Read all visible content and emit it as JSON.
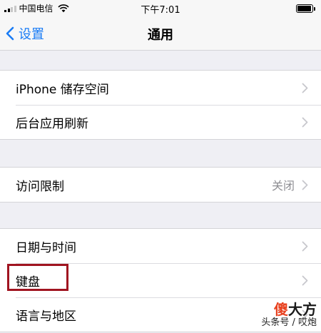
{
  "status_bar": {
    "carrier": "中国电信",
    "time": "下午7:01"
  },
  "nav": {
    "back_label": "设置",
    "title": "通用"
  },
  "groups": [
    {
      "rows": [
        {
          "label": "iPhone 储存空间",
          "value": ""
        },
        {
          "label": "后台应用刷新",
          "value": ""
        }
      ]
    },
    {
      "rows": [
        {
          "label": "访问限制",
          "value": "关闭"
        }
      ]
    },
    {
      "rows": [
        {
          "label": "日期与时间",
          "value": ""
        },
        {
          "label": "键盘",
          "value": "",
          "highlighted": true
        },
        {
          "label": "语言与地区",
          "value": ""
        }
      ]
    }
  ],
  "icons": {
    "back": "chevron-left-icon",
    "row_disclosure": "chevron-right-icon",
    "wifi": "wifi-icon",
    "battery": "battery-icon",
    "signal": "signal-icon"
  },
  "colors": {
    "accent": "#1a7cf5",
    "highlight_box": "#a01420",
    "background": "#efeff4"
  },
  "watermark": {
    "brand_part1": "傻",
    "brand_part2": "大方",
    "subtitle": "头条号 / 哎炮"
  }
}
